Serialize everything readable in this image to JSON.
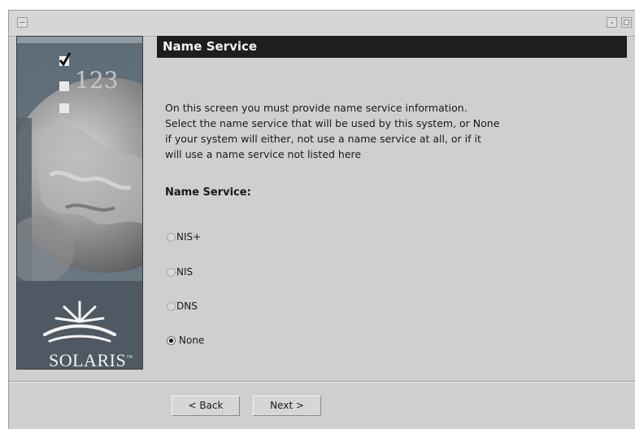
{
  "window": {
    "title": ""
  },
  "branding": {
    "logo_text": "SOLARIS",
    "trademark": "™",
    "steps_text": "123"
  },
  "header": {
    "title": "Name Service"
  },
  "description": {
    "lines": [
      "On this screen you must provide name service information.",
      "Select the name service that will be used by this system, or None",
      "if your system will either, not use a name service at all, or if it",
      "will use a name service not listed here"
    ]
  },
  "field": {
    "label": "Name Service:"
  },
  "options": [
    {
      "label": "NIS+",
      "checked": false
    },
    {
      "label": "NIS",
      "checked": false
    },
    {
      "label": "DNS",
      "checked": false
    },
    {
      "label": "None",
      "checked": true
    }
  ],
  "buttons": {
    "back_label": "< Back",
    "next_label": "Next >"
  },
  "colors": {
    "header_bg": "#1e1e1e",
    "window_bg": "#cfcfcf",
    "panel_bg": "#6f7e8a"
  },
  "icons": {
    "title_menu": "window-menu-icon",
    "title_min": "minimize-icon",
    "title_max": "maximize-icon",
    "sun_logo": "solaris-sun-icon"
  }
}
